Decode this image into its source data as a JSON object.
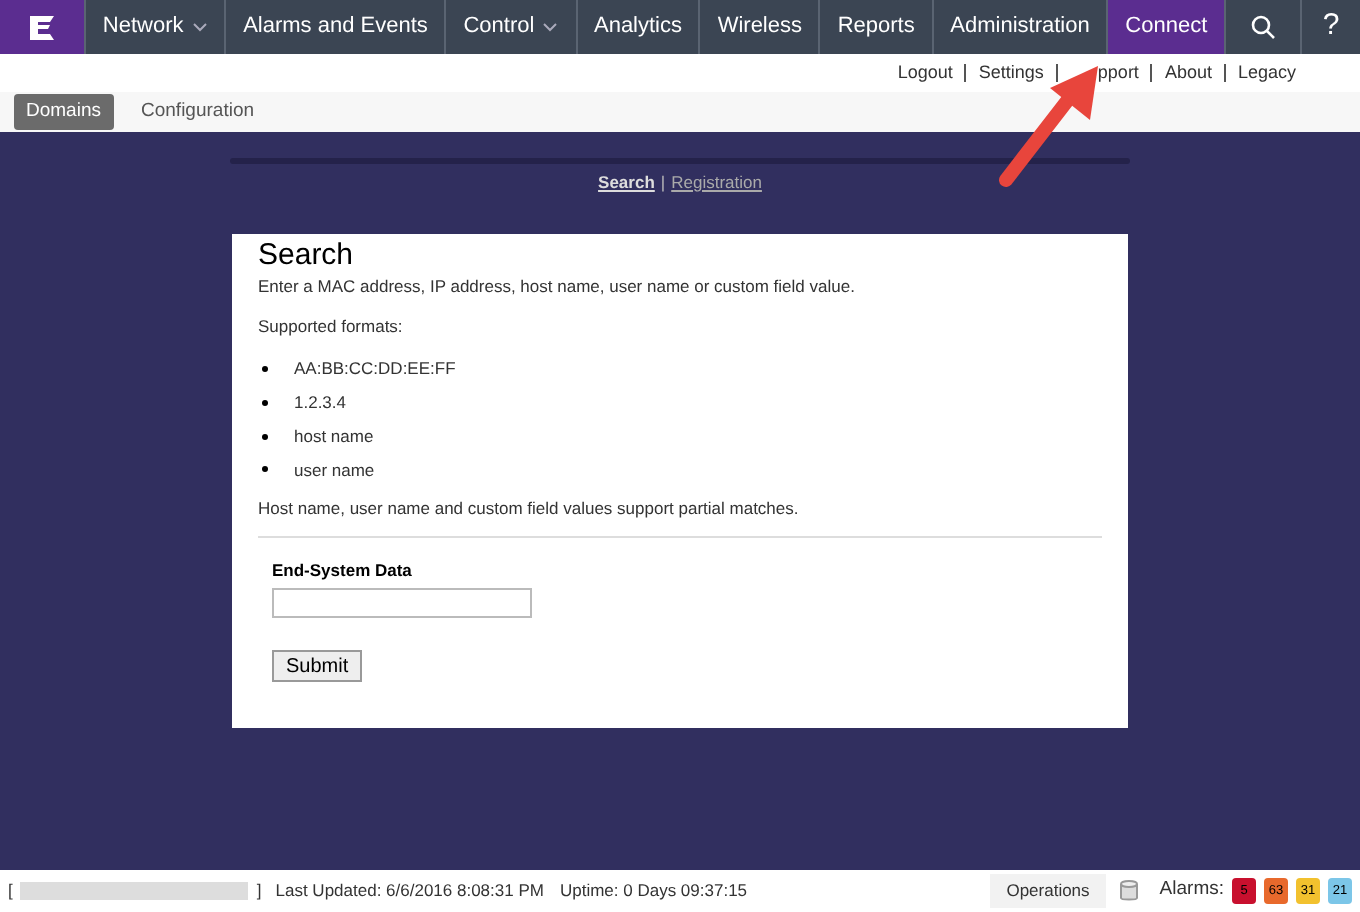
{
  "nav": {
    "items": [
      {
        "label": "Network",
        "dropdown": true,
        "selected": false
      },
      {
        "label": "Alarms and Events",
        "dropdown": false,
        "selected": false
      },
      {
        "label": "Control",
        "dropdown": true,
        "selected": false
      },
      {
        "label": "Analytics",
        "dropdown": false,
        "selected": false
      },
      {
        "label": "Wireless",
        "dropdown": false,
        "selected": false
      },
      {
        "label": "Reports",
        "dropdown": false,
        "selected": false
      },
      {
        "label": "Administration",
        "dropdown": false,
        "selected": false
      },
      {
        "label": "Connect",
        "dropdown": false,
        "selected": true
      }
    ],
    "help": "?"
  },
  "top_links": [
    "Logout",
    "Settings",
    "pport",
    "About",
    "Legacy"
  ],
  "tabs": [
    {
      "label": "Domains",
      "selected": true
    },
    {
      "label": "Configuration",
      "selected": false
    }
  ],
  "subnav": [
    {
      "label": "Search",
      "selected": true
    },
    {
      "label": "Registration",
      "selected": false
    }
  ],
  "subnav_separator": "|",
  "card": {
    "title": "Search",
    "intro": "Enter a MAC address, IP address, host name, user name or custom field value.",
    "formats_label": "Supported formats:",
    "formats": [
      "AA:BB:CC:DD:EE:FF",
      "1.2.3.4",
      "host name",
      "user name"
    ],
    "note": "Host name, user name and custom field values support partial matches.",
    "field_label": "End-System Data",
    "submit": "Submit"
  },
  "status_bar": {
    "open_bracket": "[",
    "close_bracket": "]",
    "last_updated": "Last Updated: 6/6/2016 8:08:31 PM",
    "uptime": "Uptime: 0 Days 09:37:15",
    "operations": "Operations",
    "alarms_label": "Alarms:",
    "alarms": [
      {
        "count": "5",
        "color": "#c8102e"
      },
      {
        "count": "63",
        "color": "#e8692c"
      },
      {
        "count": "31",
        "color": "#f2c12e"
      },
      {
        "count": "21",
        "color": "#7cc6e8"
      }
    ]
  }
}
